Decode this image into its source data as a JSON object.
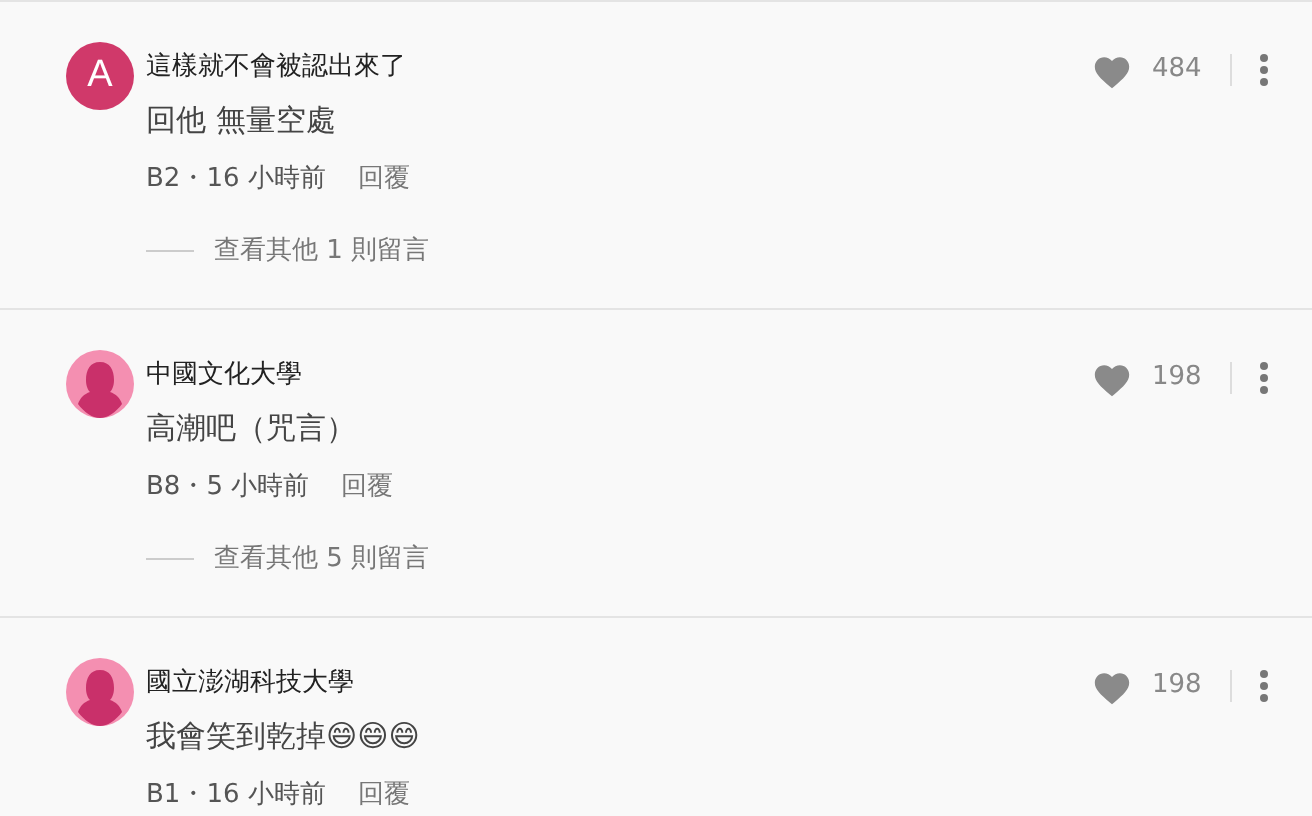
{
  "comments": [
    {
      "avatar": {
        "kind": "letter",
        "letter": "A",
        "color": "#d0396a"
      },
      "author": "這樣就不會被認出來了",
      "text": "回他 無量空處",
      "meta": "B2・16 小時前",
      "reply": "回覆",
      "likes": "484",
      "more_replies": "查看其他 1 則留言"
    },
    {
      "avatar": {
        "kind": "silhouette",
        "color": "#f48fb1"
      },
      "author": "中國文化大學",
      "text": "高潮吧（咒言）",
      "meta": "B8・5 小時前",
      "reply": "回覆",
      "likes": "198",
      "more_replies": "查看其他 5 則留言"
    },
    {
      "avatar": {
        "kind": "silhouette",
        "color": "#f48fb1"
      },
      "author": "國立澎湖科技大學",
      "text": "我會笑到乾掉😄😄😄",
      "meta": "B1・16 小時前",
      "reply": "回覆",
      "likes": "198"
    }
  ]
}
